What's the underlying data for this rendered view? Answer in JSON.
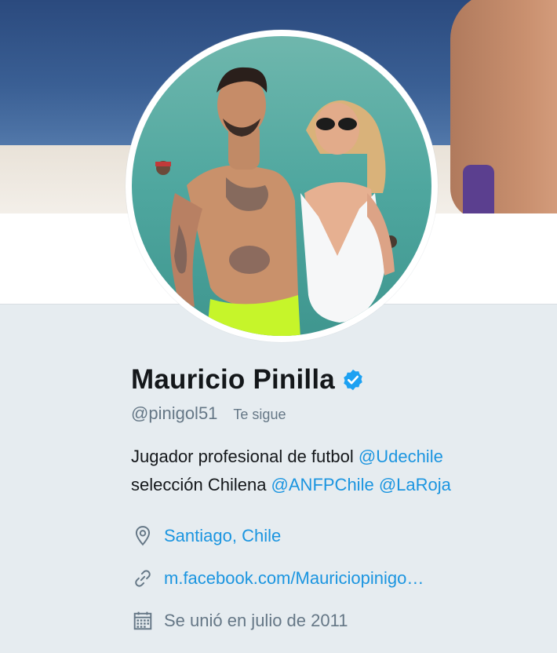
{
  "profile": {
    "name": "Mauricio Pinilla",
    "handle": "@pinigol51",
    "follows_badge": "Te sigue",
    "bio_line1_text": "Jugador profesional de futbol ",
    "bio_line1_mention": "@Udechile",
    "bio_line2_text": "selección Chilena ",
    "bio_line2_mention1": "@ANFPChile",
    "bio_line2_mention2": "@LaRoja",
    "location": "Santiago, Chile",
    "website": "m.facebook.com/Mauriciopinigo…",
    "joined": "Se unió en julio de 2011"
  },
  "icons": {
    "verified": "verified-badge-icon",
    "location": "location-pin-icon",
    "website": "link-icon",
    "joined": "calendar-icon"
  },
  "colors": {
    "link": "#1b95e0",
    "verified": "#1da1f2",
    "text": "#14171a",
    "secondary": "#657786",
    "background": "#e6ecf0"
  }
}
